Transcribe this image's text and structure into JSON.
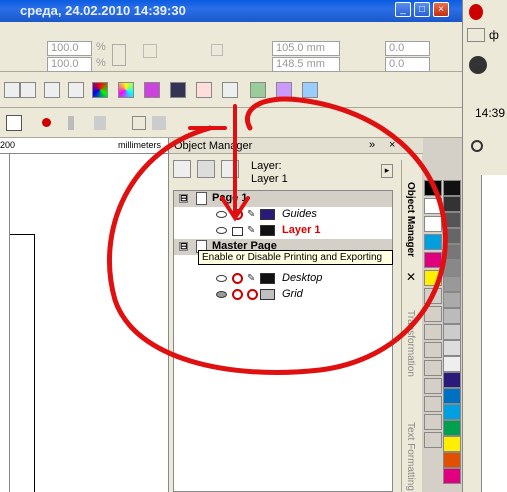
{
  "window": {
    "title": "среда, 24.02.2010 14:39:30",
    "buttons": [
      "_",
      "□",
      "×"
    ]
  },
  "property_bar": {
    "scale_x": "100.0",
    "scale_y": "100.0",
    "percent": "%",
    "width": "105.0 mm",
    "height": "148.5 mm",
    "angle_a": "0.0",
    "angle_b": "0.0"
  },
  "ruler": {
    "value": "200",
    "units": "millimeters"
  },
  "object_manager": {
    "title": "Object Manager",
    "layer_label": "Layer:",
    "layer_name": "Layer 1",
    "tree": [
      {
        "type": "page",
        "label": "Page 1",
        "expanded": "⊟"
      },
      {
        "type": "layer",
        "name": "Guides",
        "color": "#2a1a7a",
        "active": false
      },
      {
        "type": "layer",
        "name": "Layer 1",
        "color": "#111111",
        "active": true
      },
      {
        "type": "page",
        "label": "Master Page",
        "expanded": "⊟"
      },
      {
        "type": "layer",
        "name": "Desktop",
        "color": "#111111",
        "active": false
      },
      {
        "type": "layer",
        "name": "Grid",
        "color": "#c0c0c0",
        "active": false
      }
    ],
    "tooltip": "Enable or Disable Printing and Exporting"
  },
  "side_tabs": [
    "Object Manager",
    "Transformation",
    "Text Formatting"
  ],
  "palette": {
    "left": [
      "#000000",
      "#ffffff",
      "#ffffff",
      "#00a0e0",
      "#e0007f",
      "#ffee00",
      "#d4d0c8",
      "#d4d0c8",
      "#d4d0c8",
      "#d4d0c8",
      "#d4d0c8",
      "#d4d0c8",
      "#d4d0c8",
      "#d4d0c8",
      "#d4d0c8"
    ],
    "right": [
      "#111111",
      "#333333",
      "#555555",
      "#666666",
      "#777777",
      "#888888",
      "#999999",
      "#aaaaaa",
      "#bbbbbb",
      "#cccccc",
      "#dddddd",
      "#eeeeee",
      "#2a1a7a",
      "#0070c0",
      "#00a0e0",
      "#00a050",
      "#ffee00",
      "#e05000",
      "#e0007f"
    ]
  },
  "right_app": {
    "time": "14:39",
    "letter": "ф"
  },
  "colors": {
    "annotation": "#e01010",
    "title_bar": "#1b58c9"
  }
}
